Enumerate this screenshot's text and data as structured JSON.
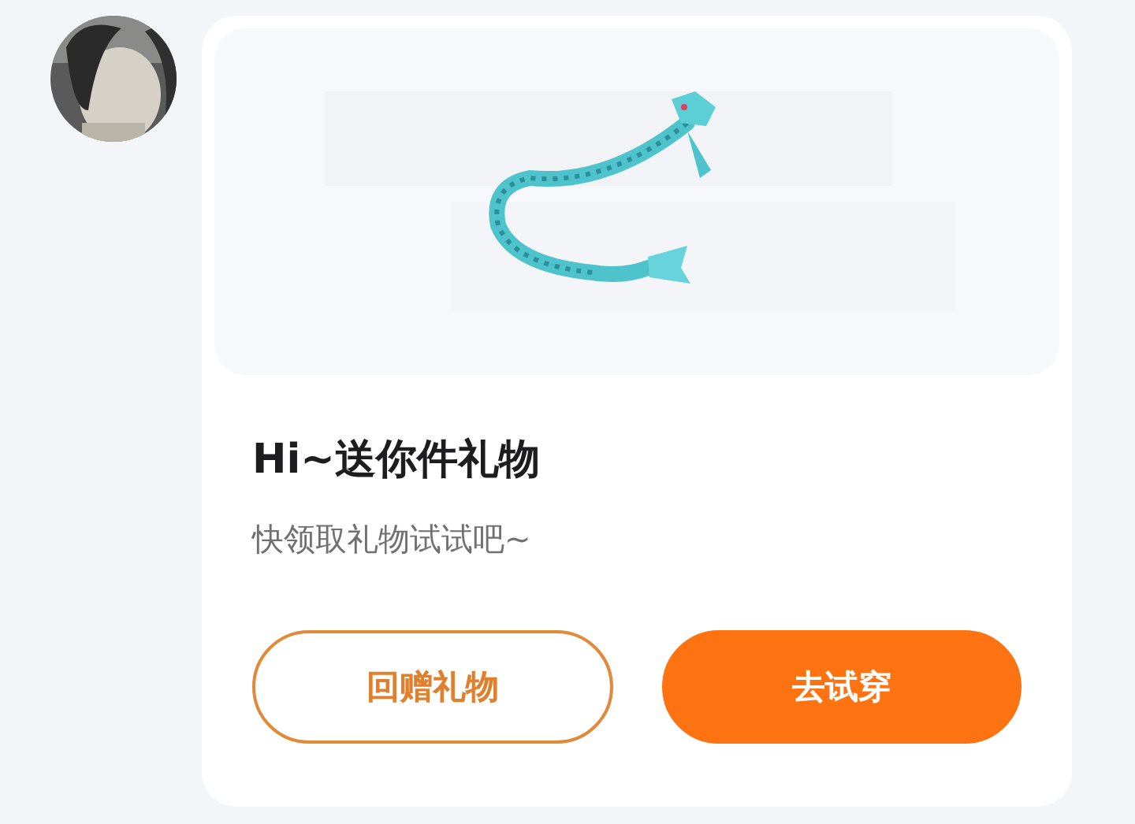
{
  "message": {
    "title": "Hi~送你件礼物",
    "subtitle": "快领取礼物试试吧~",
    "buttons": [
      {
        "label": "回赠礼物",
        "kind": "outline"
      },
      {
        "label": "去试穿",
        "kind": "filled"
      }
    ]
  }
}
